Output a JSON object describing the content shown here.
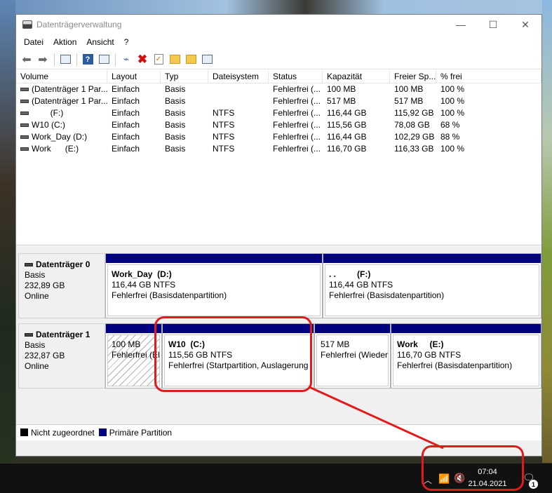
{
  "window": {
    "title": "Datenträgerverwaltung",
    "minimize": "—",
    "maximize": "☐",
    "close": "✕"
  },
  "menu": [
    "Datei",
    "Aktion",
    "Ansicht",
    "?"
  ],
  "toolbar_icons": [
    "back-arrow-icon",
    "forward-arrow-icon",
    "console-icon",
    "help-icon",
    "properties-icon",
    "connect-drive-icon",
    "delete-icon",
    "check-icon",
    "folder-up-icon",
    "folder-search-icon",
    "settings-icon"
  ],
  "volumes": {
    "headers": [
      "Volume",
      "Layout",
      "Typ",
      "Dateisystem",
      "Status",
      "Kapazität",
      "Freier Sp...",
      "% frei"
    ],
    "rows": [
      [
        "(Datenträger 1 Par...",
        "Einfach",
        "Basis",
        "",
        "Fehlerfrei (...",
        "100 MB",
        "100 MB",
        "100 %"
      ],
      [
        "(Datenträger 1 Par...",
        "Einfach",
        "Basis",
        "",
        "Fehlerfrei (...",
        "517 MB",
        "517 MB",
        "100 %"
      ],
      [
        "        (F:)",
        "Einfach",
        "Basis",
        "NTFS",
        "Fehlerfrei (...",
        "116,44 GB",
        "115,92 GB",
        "100 %"
      ],
      [
        "W10 (C:)",
        "Einfach",
        "Basis",
        "NTFS",
        "Fehlerfrei (...",
        "115,56 GB",
        "78,08 GB",
        "68 %"
      ],
      [
        "Work_Day (D:)",
        "Einfach",
        "Basis",
        "NTFS",
        "Fehlerfrei (...",
        "116,44 GB",
        "102,29 GB",
        "88 %"
      ],
      [
        "Work      (E:)",
        "Einfach",
        "Basis",
        "NTFS",
        "Fehlerfrei (...",
        "116,70 GB",
        "116,33 GB",
        "100 %"
      ]
    ]
  },
  "disk0": {
    "name": "Datenträger 0",
    "type": "Basis",
    "size": "232,89 GB",
    "state": "Online",
    "partitions": [
      {
        "name": "Work_Day  (D:)",
        "size": "116,44 GB NTFS",
        "status": "Fehlerfrei (Basisdatenpartition)"
      },
      {
        "name": ". .         (F:)",
        "size": "116,44 GB NTFS",
        "status": "Fehlerfrei (Basisdatenpartition)"
      }
    ]
  },
  "disk1": {
    "name": "Datenträger 1",
    "type": "Basis",
    "size": "232,87 GB",
    "state": "Online",
    "partitions": [
      {
        "name": "",
        "size": "100 MB",
        "status": "Fehlerfrei (EF"
      },
      {
        "name": "W10  (C:)",
        "size": "115,56 GB NTFS",
        "status": "Fehlerfrei (Startpartition, Auslagerung"
      },
      {
        "name": "",
        "size": "517 MB",
        "status": "Fehlerfrei (Wiederh"
      },
      {
        "name": "Work     (E:)",
        "size": "116,70 GB NTFS",
        "status": "Fehlerfrei (Basisdatenpartition)"
      }
    ]
  },
  "legend": [
    {
      "label": "Nicht zugeordnet",
      "color": "#000000"
    },
    {
      "label": "Primäre Partition",
      "color": "#000080"
    }
  ],
  "taskbar": {
    "time": "07:04",
    "date": "21.04.2021",
    "notification_count": "1"
  },
  "colors": {
    "partition_bar": "#000080",
    "annotation": "#e01b1b"
  }
}
